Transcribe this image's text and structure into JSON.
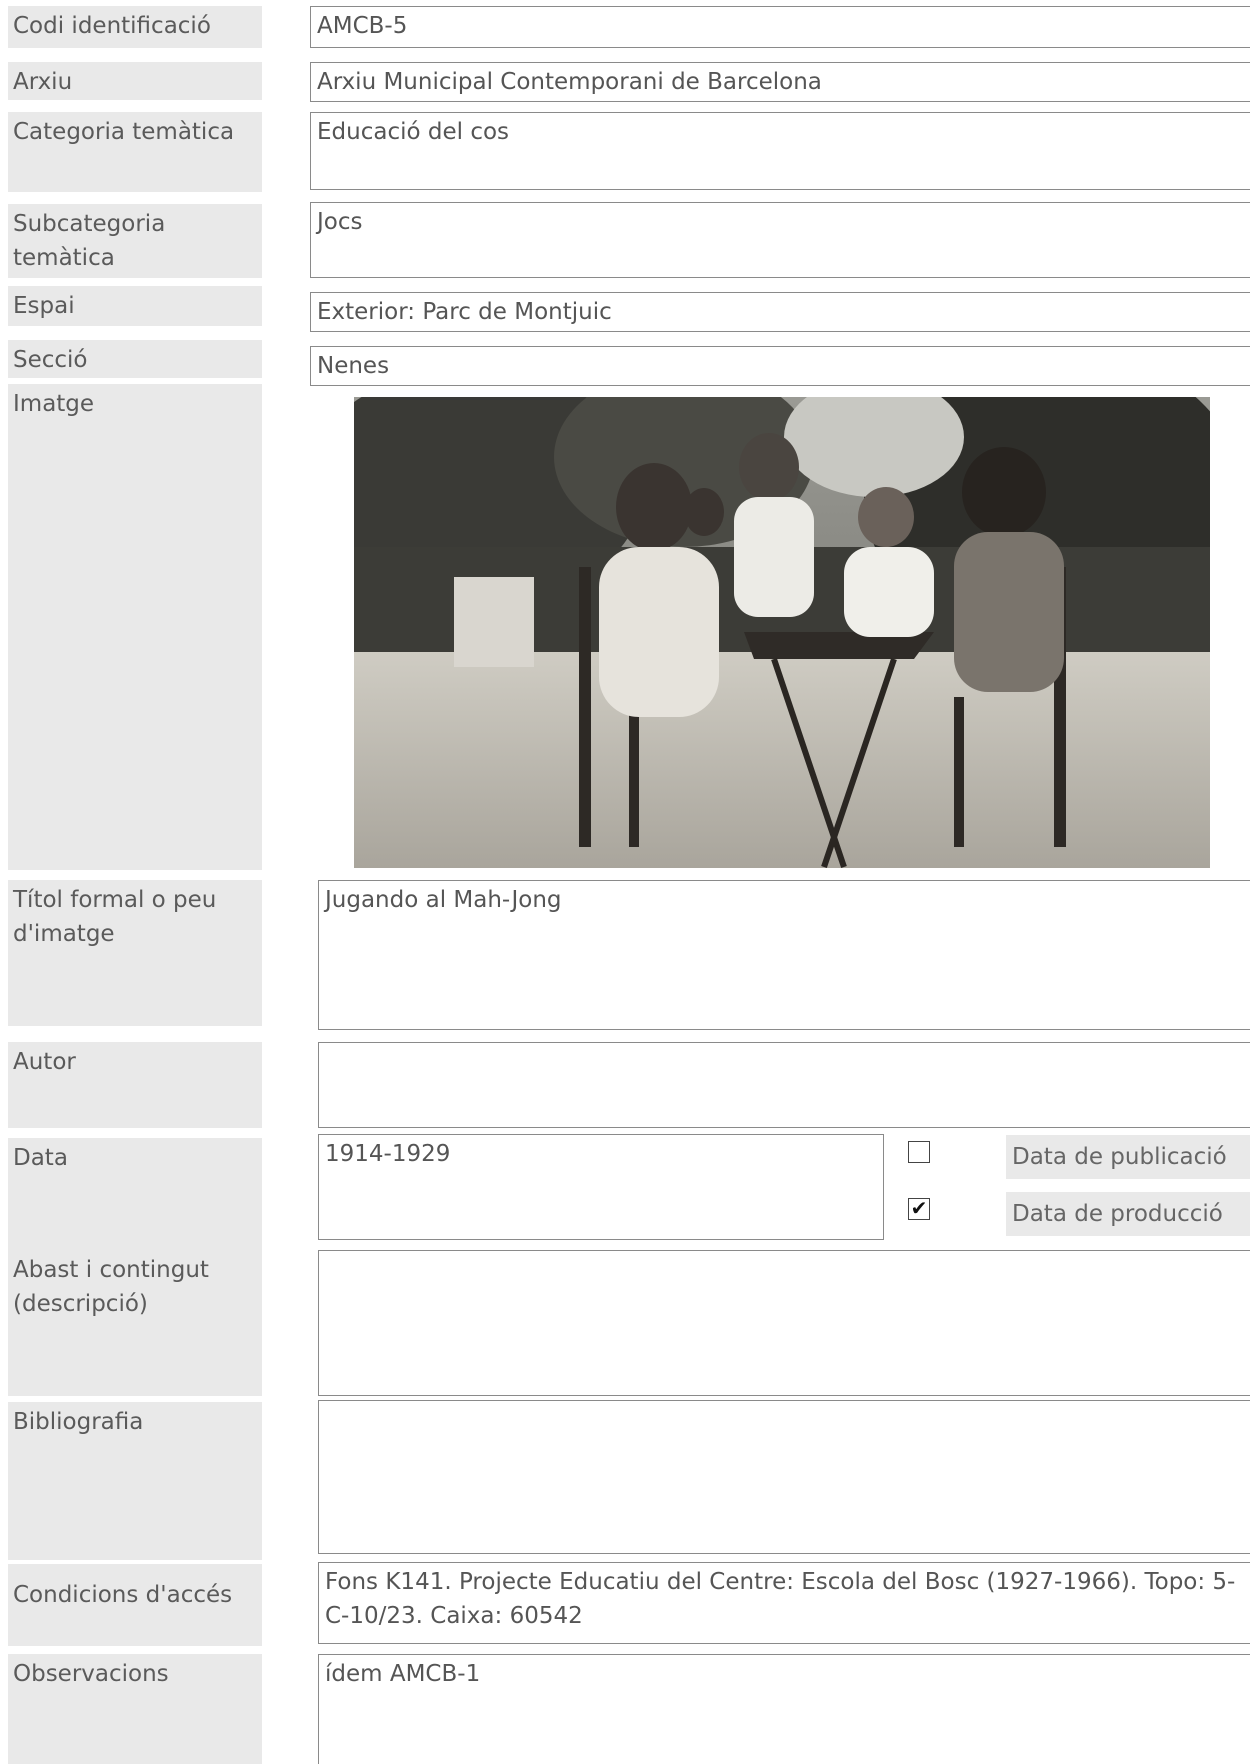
{
  "labels": {
    "codi": "Codi identificació",
    "arxiu": "Arxiu",
    "categoria": "Categoria temàtica",
    "subcategoria": "Subcategoria temàtica",
    "espai": "Espai",
    "seccio": "Secció",
    "imatge": "Imatge",
    "titol": "Títol formal o peu d'imatge",
    "autor": "Autor",
    "data": "Data",
    "abast": "Abast i contingut (descripció)",
    "bibliografia": "Bibliografia",
    "condicions": "Condicions d'accés",
    "observacions": "Observacions"
  },
  "values": {
    "codi": "AMCB-5",
    "arxiu": "Arxiu Municipal Contemporani de Barcelona",
    "categoria": "Educació del cos",
    "subcategoria": "Jocs",
    "espai": "Exterior: Parc de Montjuic",
    "seccio": "Nenes",
    "titol": "Jugando al Mah-Jong",
    "autor": "",
    "data": "1914-1929",
    "abast": "",
    "bibliografia": "",
    "condicions": "Fons K141. Projecte Educatiu del Centre: Escola del Bosc (1927-1966). Topo: 5-C-10/23. Caixa: 60542",
    "observacions": "ídem AMCB-1"
  },
  "date_options": [
    {
      "label": "Data de publicació",
      "checked": false
    },
    {
      "label": "Data de producció",
      "checked": true
    }
  ]
}
